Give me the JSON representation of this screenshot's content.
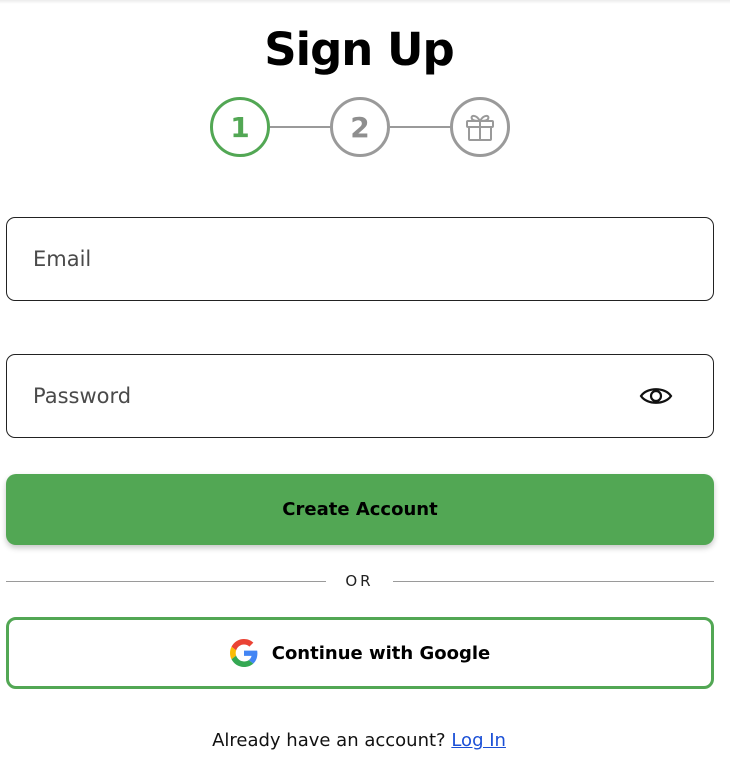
{
  "header": {
    "title": "Sign Up"
  },
  "stepper": {
    "current_step": 1,
    "steps": [
      {
        "label": "1",
        "state": "active"
      },
      {
        "label": "2",
        "state": "inactive"
      },
      {
        "icon": "gift-icon",
        "state": "inactive"
      }
    ]
  },
  "form": {
    "email": {
      "placeholder": "Email",
      "value": ""
    },
    "password": {
      "placeholder": "Password",
      "value": "",
      "toggle_icon": "eye-icon"
    },
    "submit_label": "Create Account"
  },
  "divider": {
    "text": "OR"
  },
  "google": {
    "label": "Continue with Google",
    "icon": "google-logo-icon"
  },
  "footer": {
    "prompt": "Already have an account?",
    "link_label": "Log In"
  },
  "colors": {
    "primary_green": "#52a754",
    "inactive_gray": "#9a9a9a",
    "link_blue": "#1a4fd6",
    "border_dark": "#222222"
  }
}
